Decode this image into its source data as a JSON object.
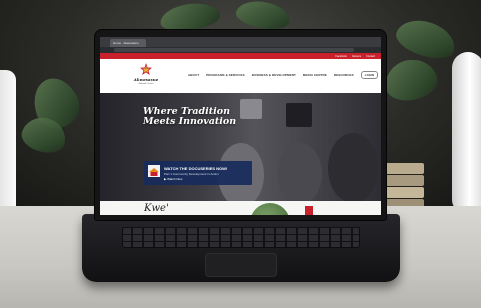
{
  "browser": {
    "tab_title": "Home · Akwesasne"
  },
  "site": {
    "topbar_links": [
      "Facebook",
      "Careers",
      "Contact"
    ],
    "logo_text": "Akwesasne",
    "logo_sub": "Mohawk Council",
    "nav": [
      "ABOUT",
      "PROGRAMS & SERVICES",
      "BUSINESS & DEVELOPMENT",
      "MEDIA CENTRE",
      "RESOURCES"
    ],
    "nav_button": "LOGIN"
  },
  "hero": {
    "title_line1": "Where Tradition",
    "title_line2": "Meets Innovation"
  },
  "video_card": {
    "title": "WATCH THE DOCUSERIES NOW!",
    "subtitle": "Part 1 Community Development in Action",
    "link": "▶ Watch Now"
  },
  "below_hero": {
    "heading": "Kwe'"
  },
  "colors": {
    "brand_red": "#c9202b",
    "card_navy": "#172b5c"
  }
}
